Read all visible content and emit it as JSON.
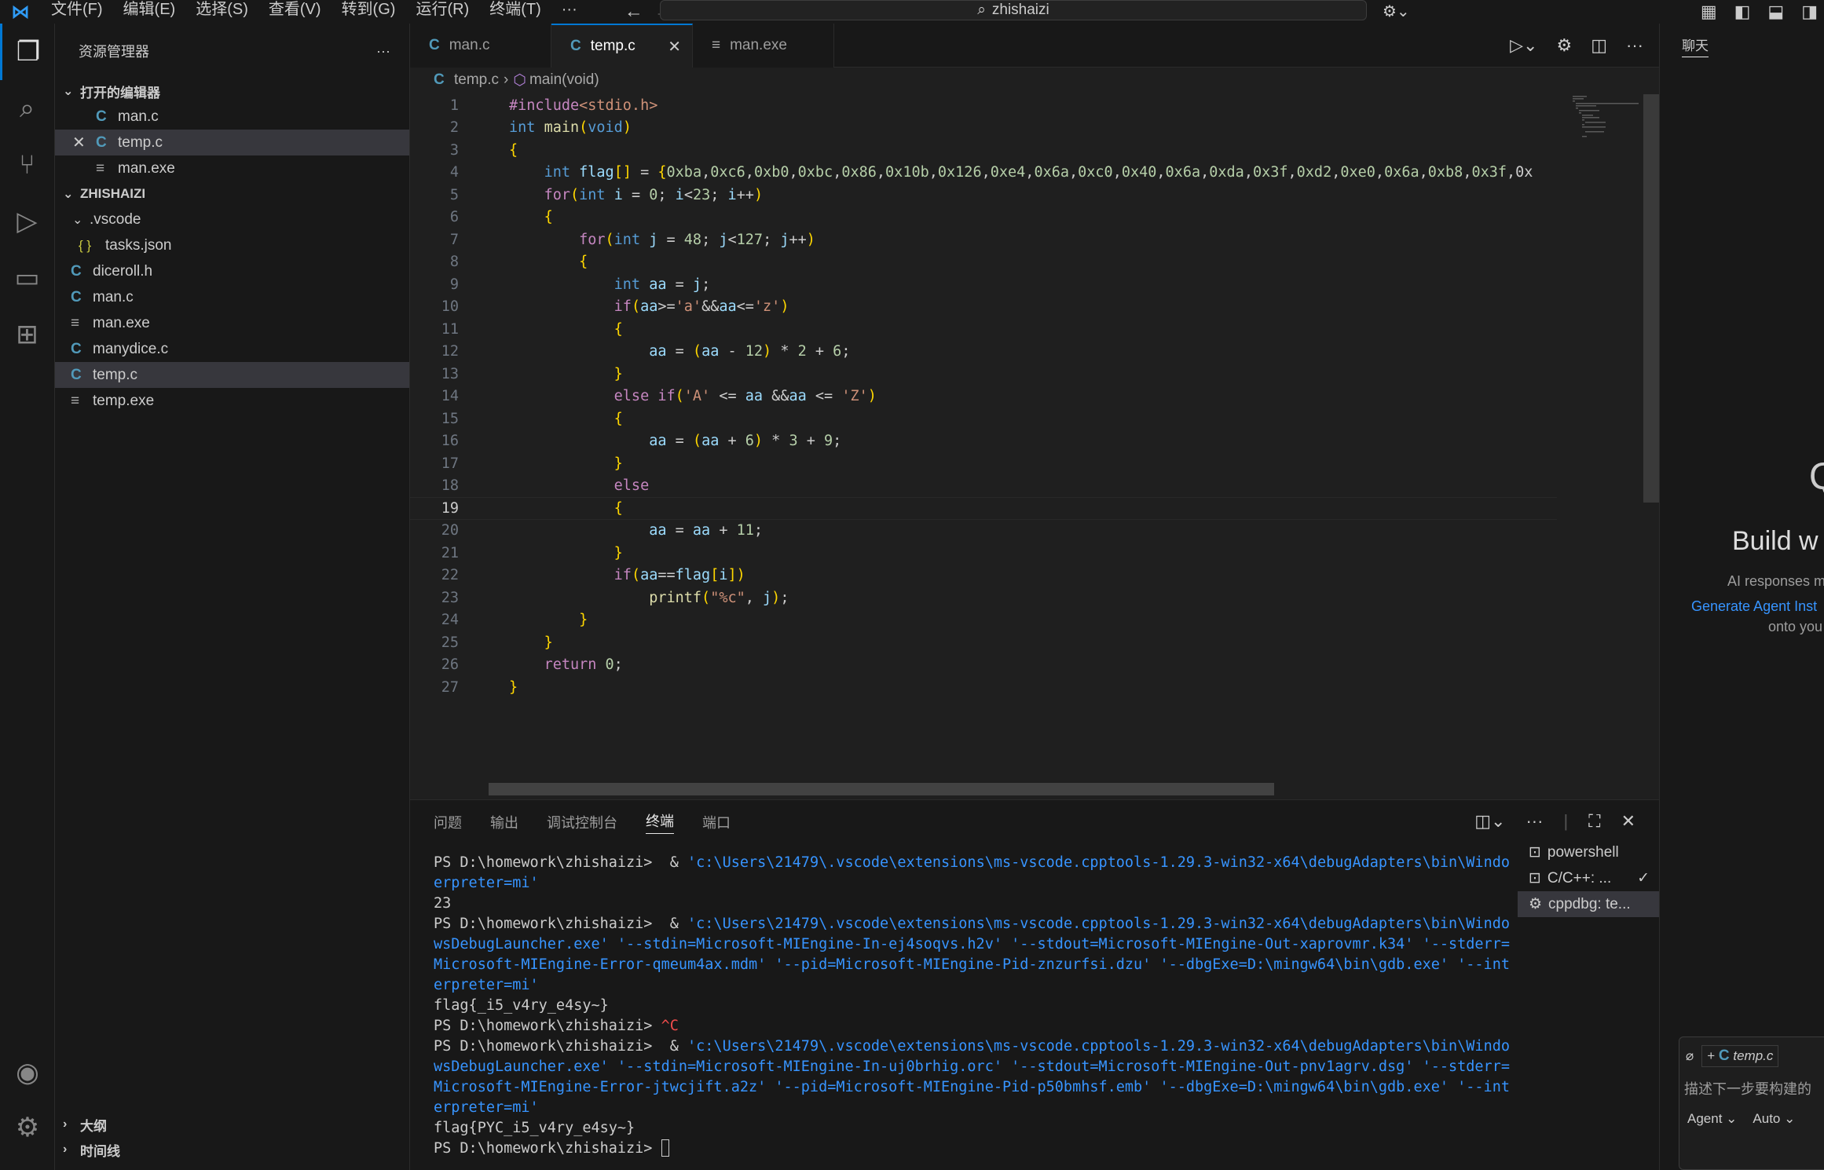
{
  "titlebar": {
    "menus": [
      "文件(F)",
      "编辑(E)",
      "选择(S)",
      "查看(V)",
      "转到(G)",
      "运行(R)",
      "终端(T)",
      "···"
    ],
    "search": "zhishaizi"
  },
  "sidebar": {
    "title": "资源管理器",
    "open_editors_label": "打开的编辑器",
    "open_editors": [
      "man.c",
      "temp.c",
      "man.exe"
    ],
    "folder_label": "ZHISHAIZI",
    "vscode_folder": ".vscode",
    "tasks_file": "tasks.json",
    "files": [
      "diceroll.h",
      "man.c",
      "man.exe",
      "manydice.c",
      "temp.c",
      "temp.exe"
    ],
    "outline_label": "大纲",
    "timeline_label": "时间线"
  },
  "tabs": [
    {
      "label": "man.c"
    },
    {
      "label": "temp.c"
    },
    {
      "label": "man.exe"
    }
  ],
  "breadcrumb": {
    "file": "temp.c",
    "symbol": "main(void)"
  },
  "line_numbers": [
    "1",
    "2",
    "3",
    "4",
    "5",
    "6",
    "7",
    "8",
    "9",
    "10",
    "11",
    "12",
    "13",
    "14",
    "15",
    "16",
    "17",
    "18",
    "19",
    "20",
    "21",
    "22",
    "23",
    "24",
    "25",
    "26",
    "27"
  ],
  "code": [
    "#include<stdio.h>",
    "int main(void)",
    "{",
    "    int flag[] = {0xba,0xc6,0xb0,0xbc,0x86,0x10b,0x126,0xe4,0x6a,0xc0,0x40,0x6a,0xda,0x3f,0xd2,0xe0,0x6a,0xb8,0x3f,0x",
    "    for(int i = 0; i<23; i++)",
    "    {",
    "        for(int j = 48; j<127; j++)",
    "        {",
    "            int aa = j;",
    "            if(aa>='a'&&aa<='z')",
    "            {",
    "                aa = (aa - 12) * 2 + 6;",
    "            }",
    "            else if('A' <= aa &&aa <= 'Z')",
    "            {",
    "                aa = (aa + 6) * 3 + 9;",
    "            }",
    "            else",
    "            {",
    "                aa = aa + 11;",
    "            }",
    "            if(aa==flag[i])",
    "                printf(\"%c\", j);",
    "        }",
    "    }",
    "    return 0;",
    "}"
  ],
  "panel": {
    "tabs": [
      "问题",
      "输出",
      "调试控制台",
      "终端",
      "端口"
    ],
    "active_tab": "终端",
    "terminals": [
      "powershell",
      "C/C++: ...",
      "cppdbg: te..."
    ]
  },
  "terminal_lines": [
    {
      "prompt": "PS D:\\homework\\zhishaizi>  & ",
      "path": "'c:\\Users\\21479\\.vscode\\extensions\\ms-vscode.cpptools-1.29.3-win32-x64\\debugAdapters\\bin\\Windo"
    },
    {
      "prompt": "",
      "path": "erpreter=mi'"
    },
    {
      "prompt": "23",
      "path": ""
    },
    {
      "prompt": "PS D:\\homework\\zhishaizi>  & ",
      "path": "'c:\\Users\\21479\\.vscode\\extensions\\ms-vscode.cpptools-1.29.3-win32-x64\\debugAdapters\\bin\\Windo"
    },
    {
      "prompt": "",
      "path": "wsDebugLauncher.exe' '--stdin=Microsoft-MIEngine-In-ej4soqvs.h2v' '--stdout=Microsoft-MIEngine-Out-xaprovmr.k34' '--stderr="
    },
    {
      "prompt": "",
      "path": "Microsoft-MIEngine-Error-qmeum4ax.mdm' '--pid=Microsoft-MIEngine-Pid-znzurfsi.dzu' '--dbgExe=D:\\mingw64\\bin\\gdb.exe' '--int"
    },
    {
      "prompt": "",
      "path": "erpreter=mi'"
    },
    {
      "prompt": "flag{_i5_v4ry_e4sy~}",
      "path": ""
    },
    {
      "prompt": "PS D:\\homework\\zhishaizi> ",
      "path": "^C"
    },
    {
      "prompt": "PS D:\\homework\\zhishaizi>  & ",
      "path": "'c:\\Users\\21479\\.vscode\\extensions\\ms-vscode.cpptools-1.29.3-win32-x64\\debugAdapters\\bin\\Windo"
    },
    {
      "prompt": "",
      "path": "wsDebugLauncher.exe' '--stdin=Microsoft-MIEngine-In-uj0brhig.orc' '--stdout=Microsoft-MIEngine-Out-pnv1agrv.dsg' '--stderr="
    },
    {
      "prompt": "",
      "path": "Microsoft-MIEngine-Error-jtwcjift.a2z' '--pid=Microsoft-MIEngine-Pid-p50bmhsf.emb' '--dbgExe=D:\\mingw64\\bin\\gdb.exe' '--int"
    },
    {
      "prompt": "",
      "path": "erpreter=mi'"
    },
    {
      "prompt": "flag{PYC_i5_v4ry_e4sy~}",
      "path": ""
    },
    {
      "prompt": "PS D:\\homework\\zhishaizi> ",
      "path": ""
    }
  ],
  "chat": {
    "tab": "聊天",
    "heading": "Build w",
    "subtitle": "AI responses m",
    "link": "Generate Agent Inst",
    "link_sub": "onto you",
    "context_file": "temp.c",
    "input_placeholder": "描述下一步要构建的",
    "mode": "Agent",
    "model": "Auto"
  }
}
